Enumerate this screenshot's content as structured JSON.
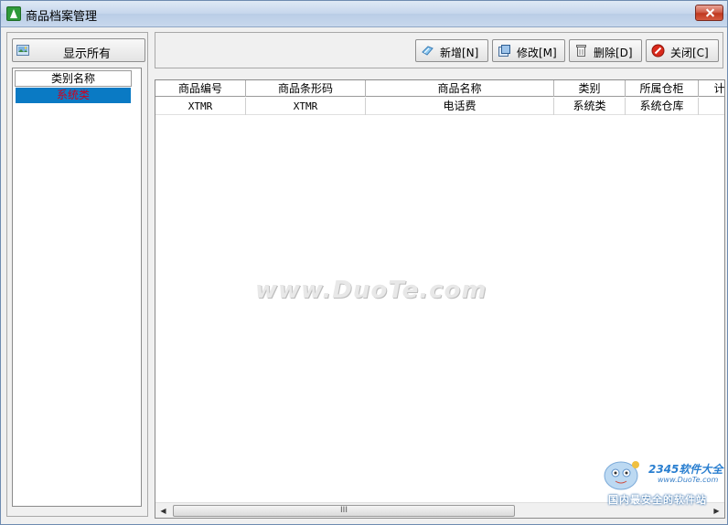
{
  "window": {
    "title": "商品档案管理"
  },
  "left_panel": {
    "show_all_label": "显示所有",
    "category_header": "类别名称",
    "categories": [
      "系统类"
    ],
    "selected_category": "系统类"
  },
  "toolbar": {
    "add_label": "新增[N]",
    "edit_label": "修改[M]",
    "delete_label": "删除[D]",
    "close_label": "关闭[C]"
  },
  "grid": {
    "columns": [
      "商品编号",
      "商品条形码",
      "商品名称",
      "类别",
      "所属仓柜",
      "计"
    ],
    "rows": [
      [
        "XTMR",
        "XTMR",
        "电话费",
        "系统类",
        "系统仓库",
        ""
      ]
    ],
    "scroll_thumb_label": "III"
  },
  "watermark": {
    "text": "www.DuoTe.com"
  },
  "badge": {
    "brand": "2345软件大全",
    "url": "www.DuoTe.com",
    "slogan": "国内最安全的软件站"
  },
  "colors": {
    "selection_bg": "#0a7ac4",
    "selection_text": "#d0001e",
    "title_close": "#c0391f"
  },
  "icons": {
    "app": "app-logo-icon",
    "show_all": "picture-icon",
    "add": "new-doc-icon",
    "edit": "edit-doc-icon",
    "delete": "trash-icon",
    "close": "close-circle-icon"
  }
}
